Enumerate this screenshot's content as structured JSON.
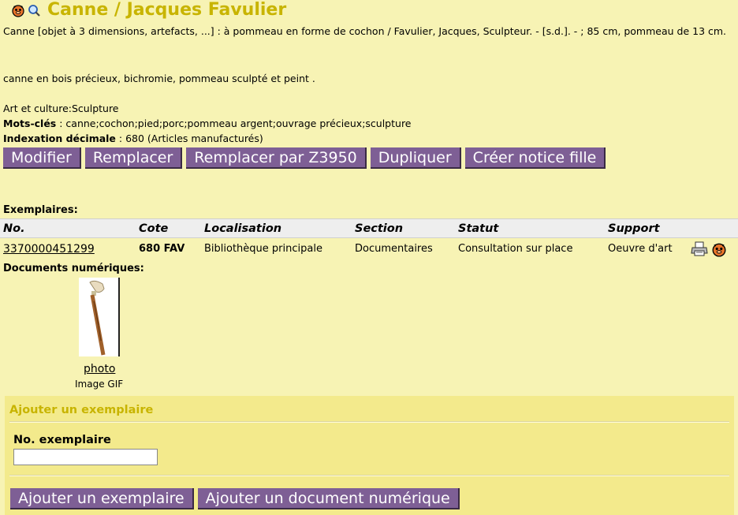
{
  "header": {
    "title": "Canne / Jacques Favulier"
  },
  "record": {
    "description": "Canne [objet à 3 dimensions, artefacts, ...] : à pommeau en forme de cochon / Favulier, Jacques, Sculpteur. - [s.d.]. - ; 85 cm, pommeau de 13 cm.",
    "note": "canne en bois précieux, bichromie, pommeau sculpté et peint .",
    "category": "Art et culture:Sculpture",
    "keywords_label": "Mots-clés",
    "keywords_value": " : canne;cochon;pied;porc;pommeau argent;ouvrage précieux;sculpture",
    "index_label": "Indexation décimale",
    "index_value": " : 680 (Articles manufacturés)"
  },
  "actions": {
    "modify": "Modifier",
    "replace": "Remplacer",
    "replace_z3950": "Remplacer par Z3950",
    "duplicate": "Dupliquer",
    "create_child": "Créer notice fille"
  },
  "copies": {
    "heading": "Exemplaires:",
    "columns": [
      "No.",
      "Cote",
      "Localisation",
      "Section",
      "Statut",
      "Support"
    ],
    "rows": [
      [
        "3370000451299",
        "680 FAV",
        "Bibliothèque principale",
        "Documentaires",
        "Consultation sur place",
        "Oeuvre d'art"
      ]
    ]
  },
  "digital": {
    "heading": "Documents numériques:",
    "link": "photo",
    "type": "Image GIF"
  },
  "add_panel": {
    "title": "Ajouter un exemplaire",
    "field_label": "No. exemplaire",
    "field_value": "",
    "add_copy_button": "Ajouter un exemplaire",
    "add_digital_button": "Ajouter un document numérique"
  },
  "colors": {
    "background": "#f7f3b4",
    "title": "#c8b400",
    "button": "#7e5f95",
    "panel": "#f3ea8c"
  }
}
